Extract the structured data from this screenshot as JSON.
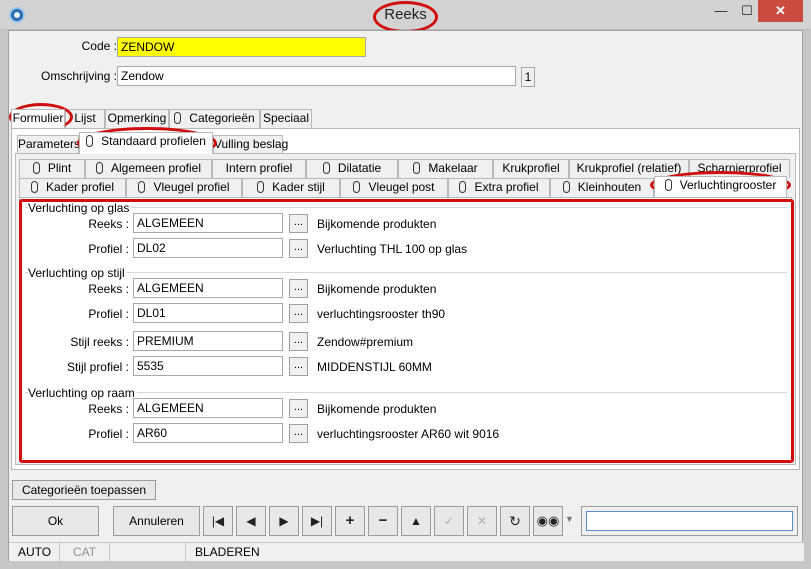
{
  "window": {
    "title": "Reeks",
    "min_glyph": "—",
    "max_glyph": "☐",
    "close_glyph": "✕"
  },
  "header": {
    "code_label": "Code :",
    "code_value": "ZENDOW",
    "omschrijving_label": "Omschrijving :",
    "omschrijving_value": "Zendow",
    "counter": "1"
  },
  "main_tabs": [
    "Formulier",
    "Lijst",
    "Opmerking",
    "Categorieën",
    "Speciaal"
  ],
  "sub_tabs": [
    "Parameters",
    "Standaard profielen",
    "Vulling beslag"
  ],
  "profile_tabs_row1": [
    "Plint",
    "Algemeen profiel",
    "Intern profiel",
    "Dilatatie",
    "Makelaar",
    "Krukprofiel",
    "Krukprofiel (relatief)",
    "Scharnierprofiel"
  ],
  "profile_tabs_row2": [
    "Kader profiel",
    "Vleugel profiel",
    "Kader stijl",
    "Vleugel post",
    "Extra profiel",
    "Kleinhouten",
    "Verluchtingrooster"
  ],
  "groups": {
    "glas": {
      "title": "Verluchting op glas",
      "reeks_label": "Reeks :",
      "reeks_value": "ALGEMEEN",
      "reeks_desc": "Bijkomende produkten",
      "profiel_label": "Profiel :",
      "profiel_value": "DL02",
      "profiel_desc": "Verluchting THL 100 op glas"
    },
    "stijl": {
      "title": "Verluchting op stijl",
      "reeks_label": "Reeks :",
      "reeks_value": "ALGEMEEN",
      "reeks_desc": "Bijkomende produkten",
      "profiel_label": "Profiel :",
      "profiel_value": "DL01",
      "profiel_desc": "verluchtingsrooster th90",
      "stijl_reeks_label": "Stijl reeks :",
      "stijl_reeks_value": "PREMIUM",
      "stijl_reeks_desc": "Zendow#premium",
      "stijl_profiel_label": "Stijl profiel :",
      "stijl_profiel_value": "5535",
      "stijl_profiel_desc": "MIDDENSTIJL 60MM"
    },
    "raam": {
      "title": "Verluchting op raam",
      "reeks_label": "Reeks :",
      "reeks_value": "ALGEMEEN",
      "reeks_desc": "Bijkomende produkten",
      "profiel_label": "Profiel :",
      "profiel_value": "AR60",
      "profiel_desc": "verluchtingsrooster AR60 wit 9016"
    }
  },
  "dots_label": "...",
  "footer": {
    "apply_categories": "Categorieën toepassen",
    "ok": "Ok",
    "annuleren": "Annuleren",
    "search_value": ""
  },
  "nav_icons": [
    "first-icon",
    "prev-icon",
    "next-icon",
    "last-icon",
    "add-icon",
    "remove-icon",
    "up-icon",
    "confirm-icon",
    "cancel-icon",
    "refresh-icon",
    "find-icon"
  ],
  "status": {
    "mode1": "AUTO",
    "mode2": "CAT",
    "mode3": "BLADEREN"
  },
  "colors": {
    "highlight": "#d10d0d",
    "code_bg": "#ffff00"
  }
}
